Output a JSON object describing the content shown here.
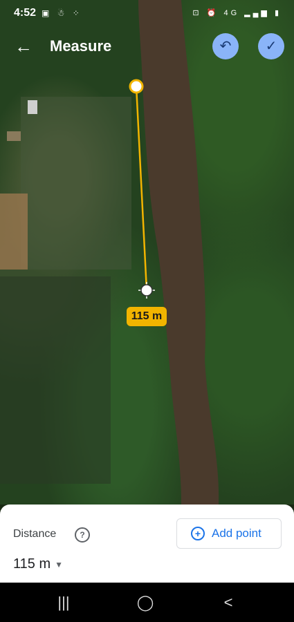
{
  "status_bar": {
    "time": "4:52",
    "left_icons": "▣ ☃ ⁘",
    "right_icons": "⊡ ⏰ 4G ▂▄▆ ▮"
  },
  "app_bar": {
    "title": "Measure",
    "back_icon": "←",
    "undo_icon": "↶",
    "done_icon": "✓"
  },
  "map": {
    "distance_label": "115 m",
    "line_color": "#f2b400"
  },
  "panel": {
    "distance_title": "Distance",
    "help_icon": "?",
    "distance_value": "115 m",
    "dropdown_icon": "▼",
    "add_point_label": "Add point",
    "add_point_icon": "+"
  },
  "nav": {
    "recents": "|||",
    "home": "◯",
    "back": "<"
  }
}
